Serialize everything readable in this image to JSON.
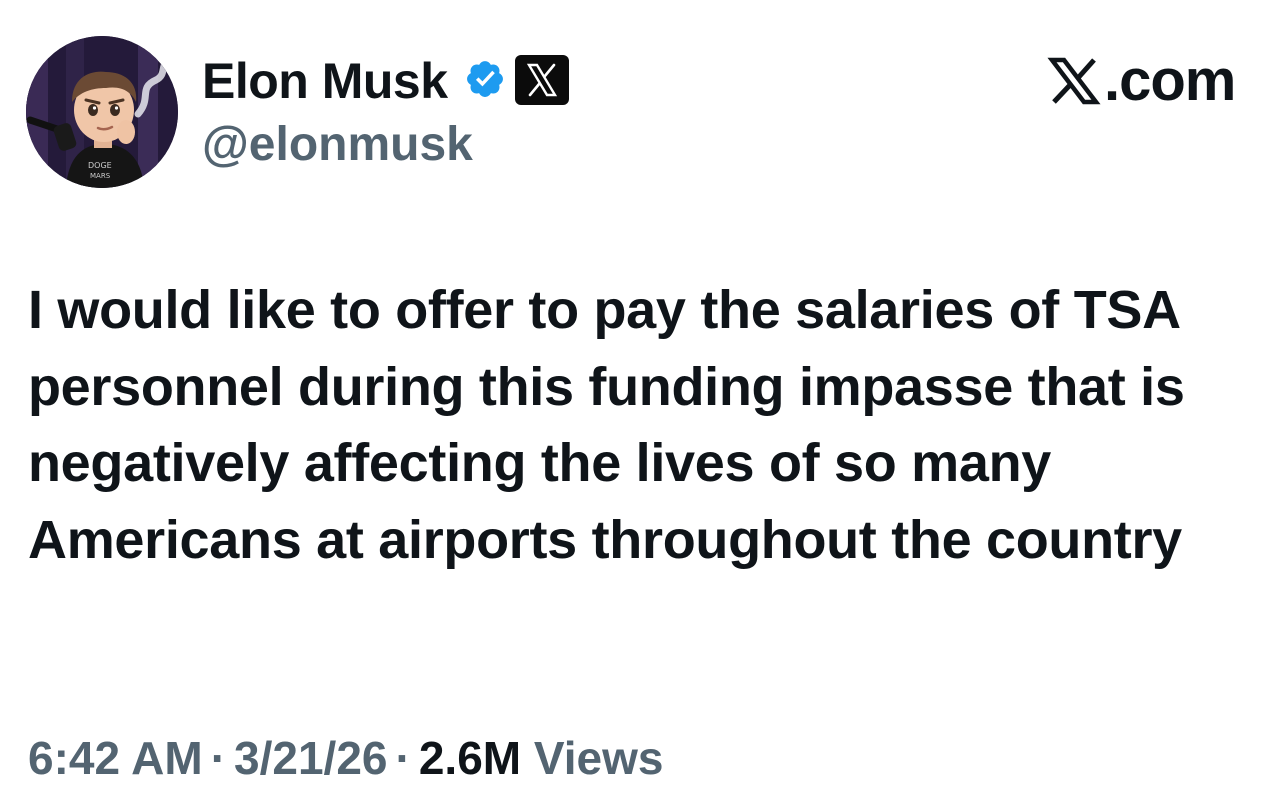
{
  "author": {
    "display_name": "Elon Musk",
    "handle": "@elonmusk",
    "verified": true,
    "affiliation_badge": "x-logo-badge"
  },
  "brand": {
    "site_label": ".com",
    "logo": "x-logo"
  },
  "tweet": {
    "text": "I would like to offer to pay the salaries of TSA personnel during this funding impasse that is negatively affecting the lives of so many Americans at airports throughout the country"
  },
  "meta": {
    "time": "6:42 AM",
    "separator": "·",
    "date": "3/21/26",
    "views_count": "2.6M",
    "views_label": "Views"
  },
  "colors": {
    "text_primary": "#0f1419",
    "text_secondary": "#536471",
    "verified_blue": "#1d9bf0",
    "badge_black": "#0b0b0b",
    "background": "#ffffff"
  },
  "icons": {
    "verified": "verified-checkmark-icon",
    "affiliation": "x-logo-icon"
  }
}
